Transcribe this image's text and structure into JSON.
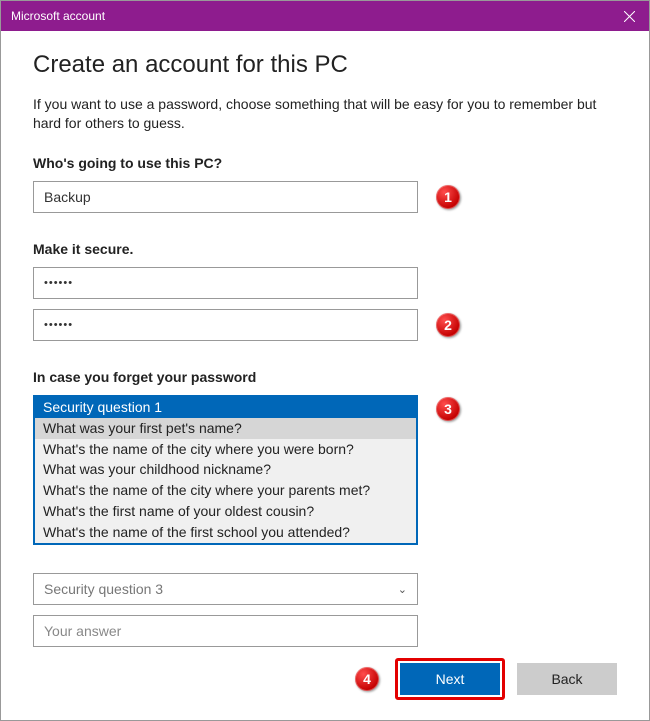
{
  "titlebar": {
    "title": "Microsoft account"
  },
  "page": {
    "heading": "Create an account for this PC",
    "intro": "If you want to use a password, choose something that will be easy for you to remember but hard for others to guess."
  },
  "user_section": {
    "label": "Who's going to use this PC?",
    "value": "Backup"
  },
  "password_section": {
    "label": "Make it secure.",
    "pw1": "••••••",
    "pw2": "••••••"
  },
  "security_section": {
    "label": "In case you forget your password",
    "q1": {
      "selected": "Security question 1",
      "hover": "What was your first pet's name?",
      "options": [
        "What's the name of the city where you were born?",
        "What was your childhood nickname?",
        "What's the name of the city where your parents met?",
        "What's the first name of your oldest cousin?",
        "What's the name of the first school you attended?"
      ]
    },
    "q3_placeholder": "Security question 3",
    "answer_placeholder": "Your answer"
  },
  "footer": {
    "next": "Next",
    "back": "Back"
  },
  "badges": {
    "b1": "1",
    "b2": "2",
    "b3": "3",
    "b4": "4"
  }
}
